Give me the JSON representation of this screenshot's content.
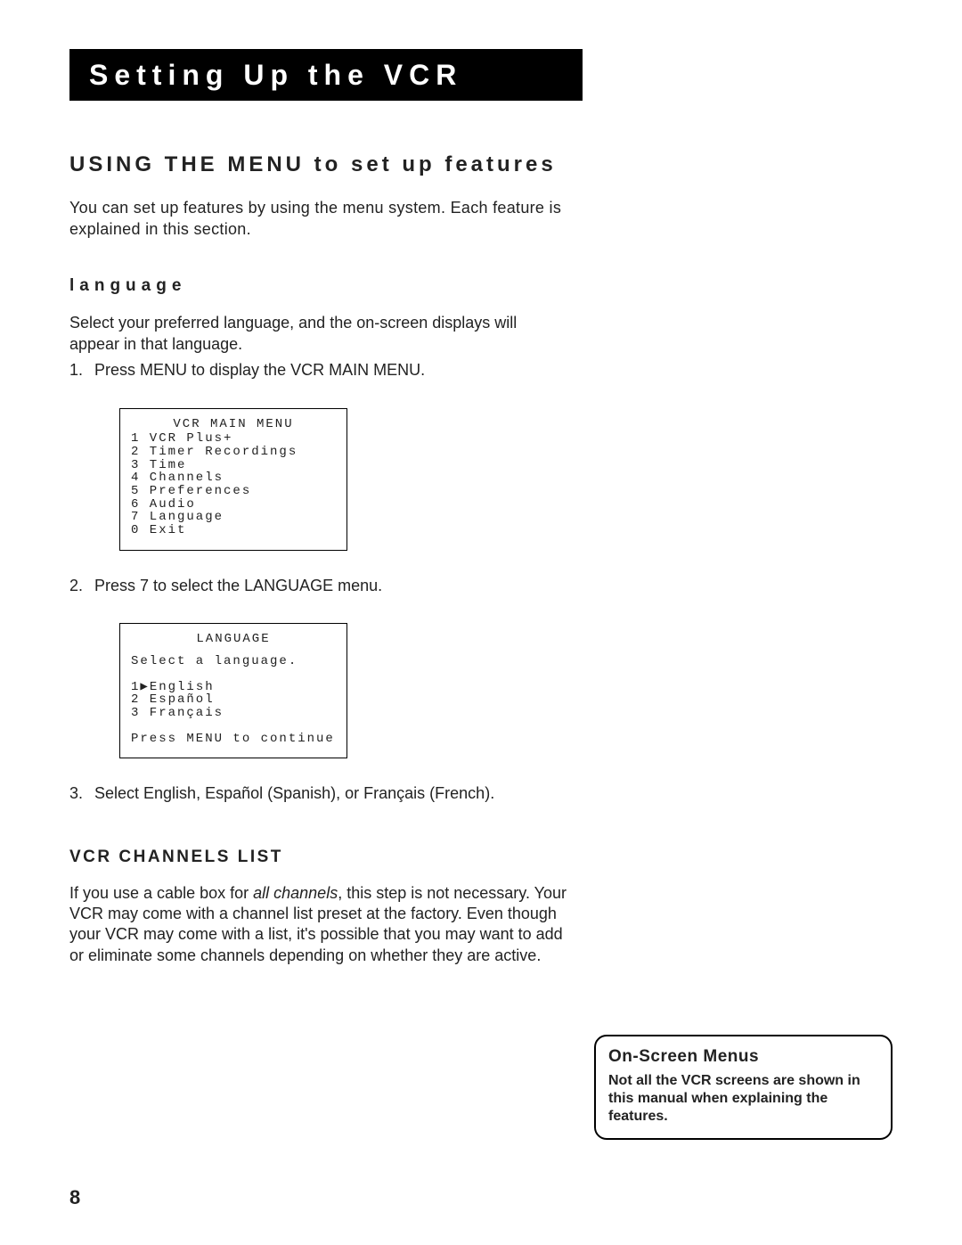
{
  "chapter_title": "Setting Up the VCR",
  "heading_using": "USING THE MENU to set up features",
  "intro": "You can set up features by using the menu system. Each feature is explained in this section.",
  "heading_language": "language",
  "language_intro": "Select your preferred language, and the on-screen displays will appear in that language.",
  "step1": "Press MENU to display the VCR MAIN MENU.",
  "main_menu": {
    "title": "VCR MAIN MENU",
    "items": [
      "1 VCR Plus+",
      "2 Timer Recordings",
      "3 Time",
      "4 Channels",
      "5 Preferences",
      "6 Audio",
      "7 Language",
      "0 Exit"
    ]
  },
  "step2": "Press 7 to select the LANGUAGE menu.",
  "lang_menu": {
    "title": "LANGUAGE",
    "instr": "Select a language.",
    "items": [
      "1▶English",
      "2 Español",
      "3 Français"
    ],
    "footer": "Press MENU to continue"
  },
  "step3": "Select English, Español (Spanish), or Français (French).",
  "heading_channels": "VCR CHANNELS LIST",
  "channels_prefix": "If you use a cable box for ",
  "channels_em": "all channels",
  "channels_suffix": ", this step is not necessary. Your VCR may come with a channel list preset at the factory. Even though your VCR may come with a list, it's possible that you may want to add or eliminate some channels depending on whether they are active.",
  "callout_title": "On-Screen Menus",
  "callout_body": "Not all the VCR screens are shown in this manual when explaining the features.",
  "page_number": "8"
}
